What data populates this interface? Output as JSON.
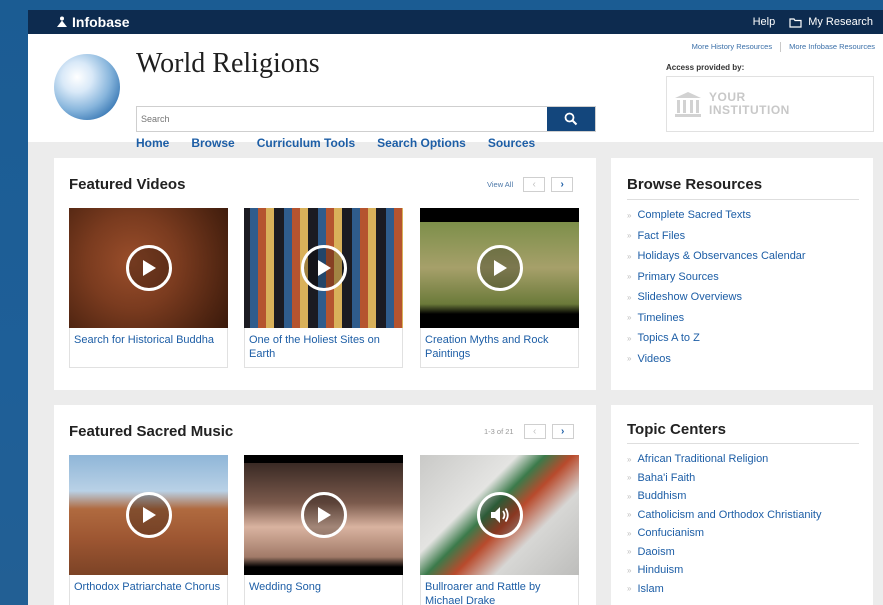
{
  "topbar": {
    "logo_bold": "Infobase",
    "help": "Help",
    "my_research": "My Research"
  },
  "header": {
    "title": "World Religions",
    "search_placeholder": "Search",
    "nav": [
      "Home",
      "Browse",
      "Curriculum Tools",
      "Search Options",
      "Sources"
    ],
    "more_history": "More History Resources",
    "more_infobase": "More Infobase Resources",
    "access_label": "Access provided by:",
    "institution_line1": "YOUR",
    "institution_line2": "INSTITUTION"
  },
  "featured_videos": {
    "title": "Featured Videos",
    "view_all": "View All",
    "cards": [
      {
        "caption": "Search for Historical Buddha"
      },
      {
        "caption": "One of the Holiest Sites on Earth"
      },
      {
        "caption": "Creation Myths and Rock Paintings"
      }
    ]
  },
  "featured_music": {
    "title": "Featured Sacred Music",
    "pager": "1-3 of 21",
    "cards": [
      {
        "caption": "Orthodox Patriarchate Chorus"
      },
      {
        "caption": "Wedding Song"
      },
      {
        "caption": "Bullroarer and Rattle by Michael Drake"
      }
    ]
  },
  "browse_resources": {
    "title": "Browse Resources",
    "items": [
      "Complete Sacred Texts",
      "Fact Files",
      "Holidays & Observances Calendar",
      "Primary Sources",
      "Slideshow Overviews",
      "Timelines",
      "Topics A to Z",
      "Videos"
    ]
  },
  "topic_centers": {
    "title": "Topic Centers",
    "items": [
      "African Traditional Religion",
      "Baha'i Faith",
      "Buddhism",
      "Catholicism and Orthodox Christianity",
      "Confucianism",
      "Daoism",
      "Hinduism",
      "Islam"
    ]
  },
  "icons": {
    "logo": "person-triangle-icon",
    "folder": "folder-icon",
    "search": "search-icon",
    "play": "play-icon",
    "audio": "speaker-icon",
    "bank": "institution-icon"
  },
  "colors": {
    "topbar": "#0d2b4f",
    "link": "#1d5ea6",
    "search_button": "#13467c"
  }
}
